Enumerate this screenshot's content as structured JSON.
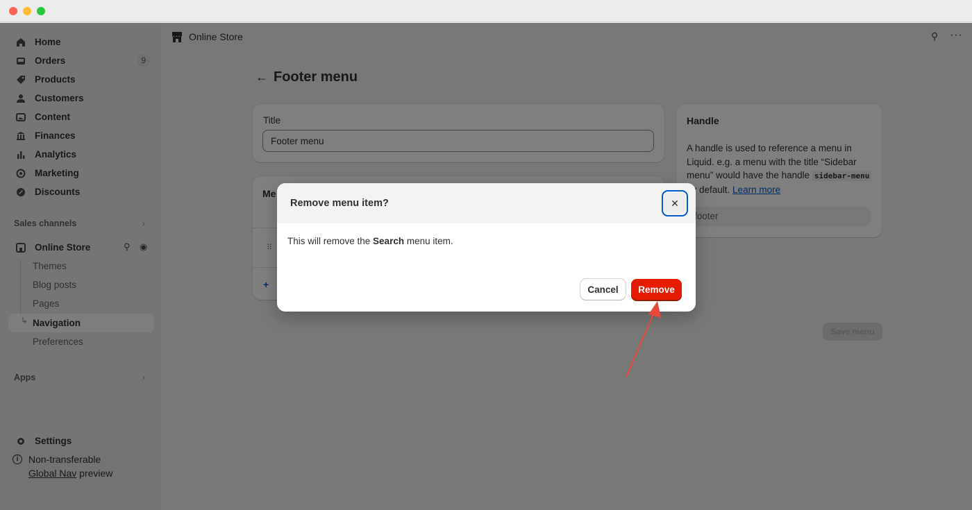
{
  "sidebar": {
    "items": [
      {
        "label": "Home",
        "icon": "home-icon"
      },
      {
        "label": "Orders",
        "icon": "inbox-icon",
        "badge": "9"
      },
      {
        "label": "Products",
        "icon": "tag-icon"
      },
      {
        "label": "Customers",
        "icon": "person-icon"
      },
      {
        "label": "Content",
        "icon": "image-icon"
      },
      {
        "label": "Finances",
        "icon": "bank-icon"
      },
      {
        "label": "Analytics",
        "icon": "bar-chart-icon"
      },
      {
        "label": "Marketing",
        "icon": "target-icon"
      },
      {
        "label": "Discounts",
        "icon": "discount-icon"
      }
    ],
    "sales_channels_label": "Sales channels",
    "online_store": {
      "label": "Online Store",
      "subitems": [
        "Themes",
        "Blog posts",
        "Pages",
        "Navigation",
        "Preferences"
      ],
      "active": "Navigation"
    },
    "apps_label": "Apps",
    "settings_label": "Settings",
    "notice": {
      "line1": "Non-transferable",
      "link": "Global Nav",
      "line2": " preview"
    }
  },
  "topbar": {
    "title": "Online Store"
  },
  "page": {
    "back_glyph": "←",
    "title": "Footer menu",
    "title_card": {
      "label": "Title",
      "value": "Footer menu"
    },
    "menu_items_card_partial": "Me",
    "add_glyph": "+",
    "handle_card": {
      "heading": "Handle",
      "text_1": "A handle is used to reference a menu in Liquid. e.g. a menu with the title “Sidebar menu” would have the handle ",
      "code": "sidebar-menu",
      "text_2": " by default. ",
      "link": "Learn more",
      "value": "footer"
    },
    "save_button": "Save menu"
  },
  "modal": {
    "title": "Remove menu item?",
    "close_glyph": "✕",
    "body_prefix": "This will remove the ",
    "body_bold": "Search",
    "body_suffix": " menu item.",
    "cancel": "Cancel",
    "remove": "Remove"
  },
  "colors": {
    "accent_blue": "#005bd3",
    "critical_red": "#e51c00",
    "annotation_arrow": "#e8473b"
  }
}
